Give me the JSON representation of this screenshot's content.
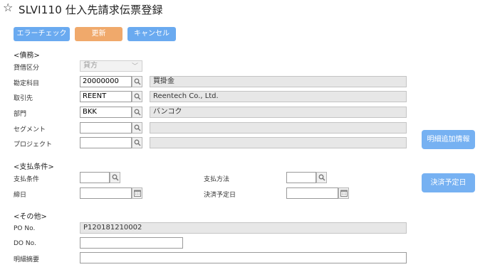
{
  "title": "SLVI110 仕入先請求伝票登録",
  "toolbar": {
    "error_check": "エラーチェック",
    "update": "更新",
    "cancel": "キャンセル"
  },
  "sections": {
    "debt": "<債務>",
    "payment": "<支払条件>",
    "other": "<その他>"
  },
  "debt": {
    "debit_credit": {
      "label": "貸借区分",
      "value": "貸方"
    },
    "account": {
      "label": "勘定科目",
      "code": "20000000",
      "name": "買掛金"
    },
    "partner": {
      "label": "取引先",
      "code": "REENT",
      "name": "Reentech Co., Ltd."
    },
    "department": {
      "label": "部門",
      "code": "BKK",
      "name": "バンコク"
    },
    "segment": {
      "label": "セグメント",
      "code": "",
      "name": ""
    },
    "project": {
      "label": "プロジェクト",
      "code": "",
      "name": ""
    }
  },
  "payment": {
    "terms": {
      "label": "支払条件",
      "value": ""
    },
    "method": {
      "label": "支払方法",
      "value": ""
    },
    "closing_date": {
      "label": "締日",
      "value": ""
    },
    "settlement_date": {
      "label": "決済予定日",
      "value": ""
    }
  },
  "other": {
    "po_no": {
      "label": "PO No.",
      "value": "P120181210002"
    },
    "do_no": {
      "label": "DO No.",
      "value": ""
    },
    "detail_summary": {
      "label": "明細摘要",
      "value": ""
    }
  },
  "side_buttons": {
    "detail_info": "明細追加情報",
    "settlement_date": "決済予定日"
  },
  "icons": {
    "title": "star-icon",
    "lookup": "search-icon",
    "date": "calendar-icon",
    "select": "chevron-down-icon"
  }
}
